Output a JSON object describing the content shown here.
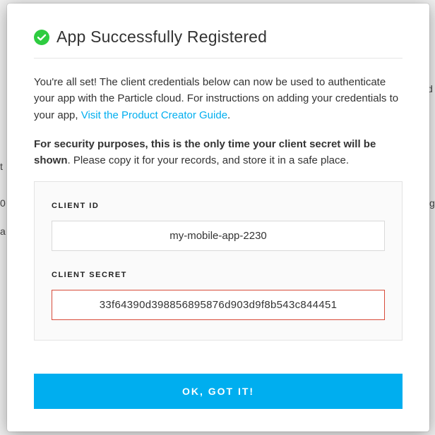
{
  "header": {
    "title": "App Successfully Registered",
    "icon": "check-circle"
  },
  "body": {
    "intro_text": "You're all set! The client credentials below can now be used to authenticate your app with the Particle cloud. For instructions on adding your credentials to your app, ",
    "link_text": "Visit the Product Creator Guide",
    "intro_suffix": ".",
    "security_bold": "For security purposes, this is the only time your client secret will be shown",
    "security_rest": ". Please copy it for your records, and store it in a safe place."
  },
  "credentials": {
    "client_id_label": "CLIENT ID",
    "client_id_value": "my-mobile-app-2230",
    "client_secret_label": "CLIENT SECRET",
    "client_secret_value": "33f64390d398856895876d903d9f8b543c844451"
  },
  "footer": {
    "button_label": "OK, GOT IT!"
  },
  "colors": {
    "accent": "#00aeef",
    "success": "#2ecc40",
    "danger_border": "#d84b3a"
  }
}
